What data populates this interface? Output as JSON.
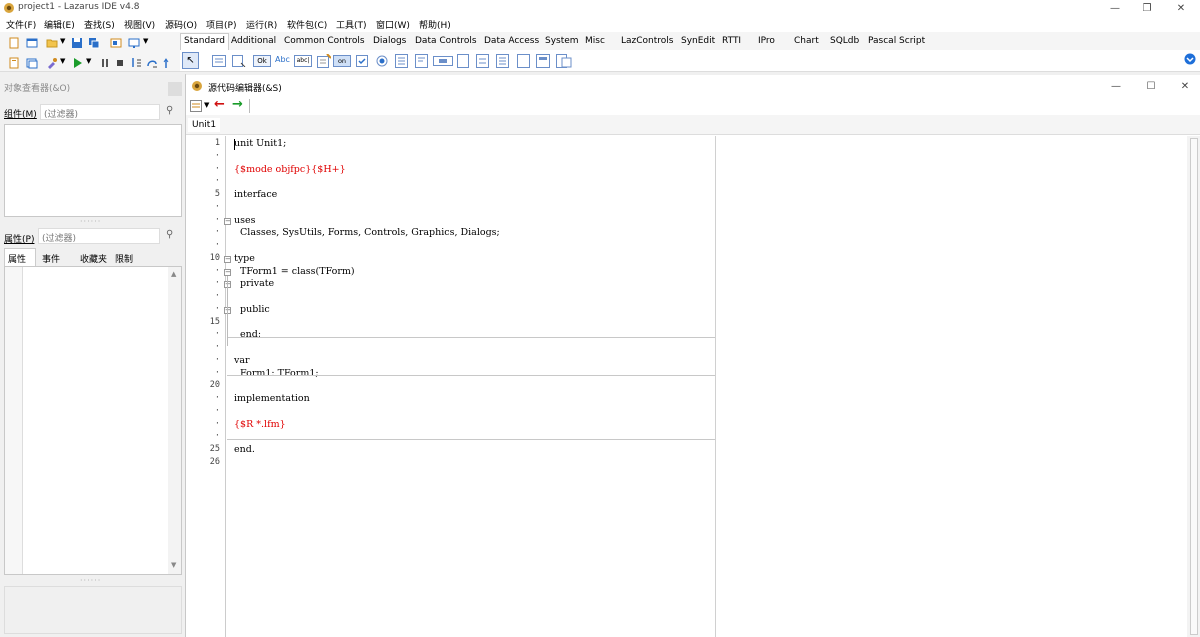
{
  "window": {
    "title": "project1  - Lazarus IDE v4.8"
  },
  "menu": [
    "文件(F)",
    "编辑(E)",
    "查找(S)",
    "视图(V)",
    "源码(O)",
    "项目(P)",
    "运行(R)",
    "软件包(C)",
    "工具(T)",
    "窗口(W)",
    "帮助(H)"
  ],
  "palette": {
    "tabs": [
      "Standard",
      "Additional",
      "Common Controls",
      "Dialogs",
      "Data Controls",
      "Data Access",
      "System",
      "Misc",
      "LazControls",
      "SynEdit",
      "RTTI",
      "IPro",
      "Chart",
      "SQLdb",
      "Pascal Script"
    ],
    "active": "Standard",
    "icon_labels": {
      "ok": "Ok",
      "abc": "Abc",
      "abc_box": "abc|",
      "on": "on"
    }
  },
  "object_inspector": {
    "title": "对象查看器(&O)",
    "components_label": "组件(M)",
    "components_filter_placeholder": "(过滤器)",
    "properties_label": "属性(P)",
    "properties_filter_placeholder": "(过滤器)",
    "tabs": [
      "属性",
      "事件",
      "收藏夹",
      "限制"
    ]
  },
  "editor": {
    "title": "源代码编辑器(&S)",
    "tab": "Unit1",
    "gutter": [
      "1",
      "·",
      "·",
      "·",
      "5",
      "·",
      "·",
      "·",
      "·",
      "10",
      "·",
      "·",
      "·",
      "·",
      "15",
      "·",
      "·",
      "·",
      "·",
      "20",
      "·",
      "·",
      "·",
      "·",
      "25",
      "26"
    ],
    "lines": [
      {
        "text": "unit Unit1;",
        "kind": "code"
      },
      {
        "text": "",
        "kind": "code"
      },
      {
        "text": "{$mode objfpc}{$H+}",
        "kind": "dir"
      },
      {
        "text": "",
        "kind": "code"
      },
      {
        "text": "interface",
        "kind": "code"
      },
      {
        "text": "",
        "kind": "code"
      },
      {
        "text": "uses",
        "kind": "code"
      },
      {
        "text": "  Classes, SysUtils, Forms, Controls, Graphics, Dialogs;",
        "kind": "code"
      },
      {
        "text": "",
        "kind": "code"
      },
      {
        "text": "type",
        "kind": "code"
      },
      {
        "text": "  TForm1 = class(TForm)",
        "kind": "code"
      },
      {
        "text": "  private",
        "kind": "code"
      },
      {
        "text": "",
        "kind": "code"
      },
      {
        "text": "  public",
        "kind": "code"
      },
      {
        "text": "",
        "kind": "code"
      },
      {
        "text": "  end;",
        "kind": "code"
      },
      {
        "text": "",
        "kind": "code"
      },
      {
        "text": "var",
        "kind": "code"
      },
      {
        "text": "  Form1: TForm1;",
        "kind": "code"
      },
      {
        "text": "",
        "kind": "code"
      },
      {
        "text": "implementation",
        "kind": "code"
      },
      {
        "text": "",
        "kind": "code"
      },
      {
        "text": "{$R *.lfm}",
        "kind": "dir"
      },
      {
        "text": "",
        "kind": "code"
      },
      {
        "text": "end.",
        "kind": "code"
      },
      {
        "text": "",
        "kind": "code"
      }
    ]
  },
  "colors": {
    "directive": "#e00000",
    "accent": "#1e6fd9"
  }
}
